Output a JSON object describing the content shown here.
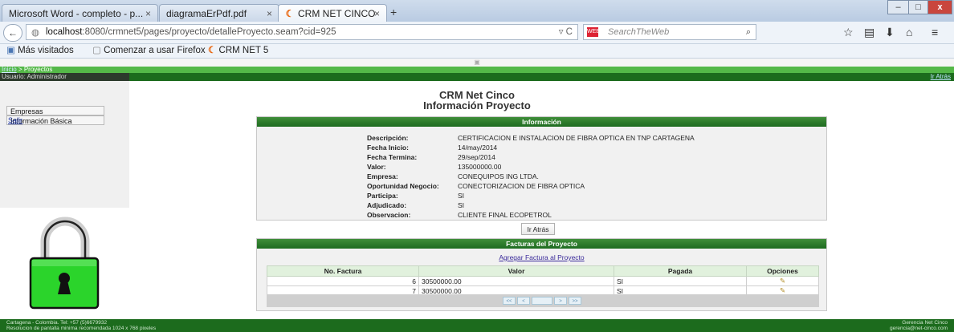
{
  "browser": {
    "tabs": [
      {
        "label": "Microsoft Word - completo - p...",
        "close": "×"
      },
      {
        "label": "diagramaErPdf.pdf",
        "close": "×"
      },
      {
        "label": "CRM NET CINCO",
        "close": "×"
      }
    ],
    "new_tab": "+",
    "window_controls": {
      "minimize": "–",
      "maximize": "□",
      "close": "x"
    },
    "url_host": "localhost",
    "url_rest": ":8080/crmnet5/pages/proyecto/detalleProyecto.seam?cid=925",
    "url_tail": "▿ C",
    "search_placeholder": "SearchTheWeb",
    "bookmarks": [
      "Más visitados",
      "Comenzar a usar Firefox",
      "CRM NET 5"
    ]
  },
  "page": {
    "breadcrumb_home": "Inicio",
    "breadcrumb_sep": " > ",
    "breadcrumb_current": "Proyectos",
    "user_label": "Usuario: Administrador",
    "back_link": "Ir Atrás",
    "menu": [
      "Empresas",
      "Información Básica"
    ],
    "logout": "Salir",
    "title_line1": "CRM Net Cinco",
    "title_line2": "Información Proyecto",
    "info_header": "Información",
    "info_rows": [
      {
        "label": "Descripción:",
        "value": "CERTIFICACION E INSTALACION DE FIBRA OPTICA EN TNP CARTAGENA"
      },
      {
        "label": "Fecha Inicio:",
        "value": "14/may/2014"
      },
      {
        "label": "Fecha Termina:",
        "value": "29/sep/2014"
      },
      {
        "label": "Valor:",
        "value": "135000000.00"
      },
      {
        "label": "Empresa:",
        "value": "CONEQUIPOS ING LTDA."
      },
      {
        "label": "Oportunidad Negocio:",
        "value": "CONECTORIZACION DE FIBRA OPTICA"
      },
      {
        "label": "Participa:",
        "value": "SI"
      },
      {
        "label": "Adjudicado:",
        "value": "SI"
      },
      {
        "label": "Observacion:",
        "value": "CLIENTE FINAL ECOPETROL"
      }
    ],
    "back_button": "Ir Atrás",
    "invoices_header": "Facturas del Proyecto",
    "add_invoice_link": "Agregar Factura al Proyecto",
    "invoice_columns": [
      "No. Factura",
      "Valor",
      "Pagada",
      "Opciones"
    ],
    "invoices": [
      {
        "number": "6",
        "value": "30500000.00",
        "paid": "SI"
      },
      {
        "number": "7",
        "value": "30500000.00",
        "paid": "SI"
      }
    ],
    "pager": [
      "<<",
      "<",
      ">",
      ">>"
    ],
    "footer_left_1": "Cartagena - Colombia. Tel: +57 (5)6679932",
    "footer_left_2": "Resolucion de pantalla minima recomendada 1024 x 768 pixeles",
    "footer_right_1": "Gerencia Net Cinco",
    "footer_right_2": "gerencia@net-cinco.com"
  },
  "colors": {
    "accent_green": "#1c6b1d",
    "crumb_green": "#54b848",
    "lock_green": "#2bd42b"
  }
}
